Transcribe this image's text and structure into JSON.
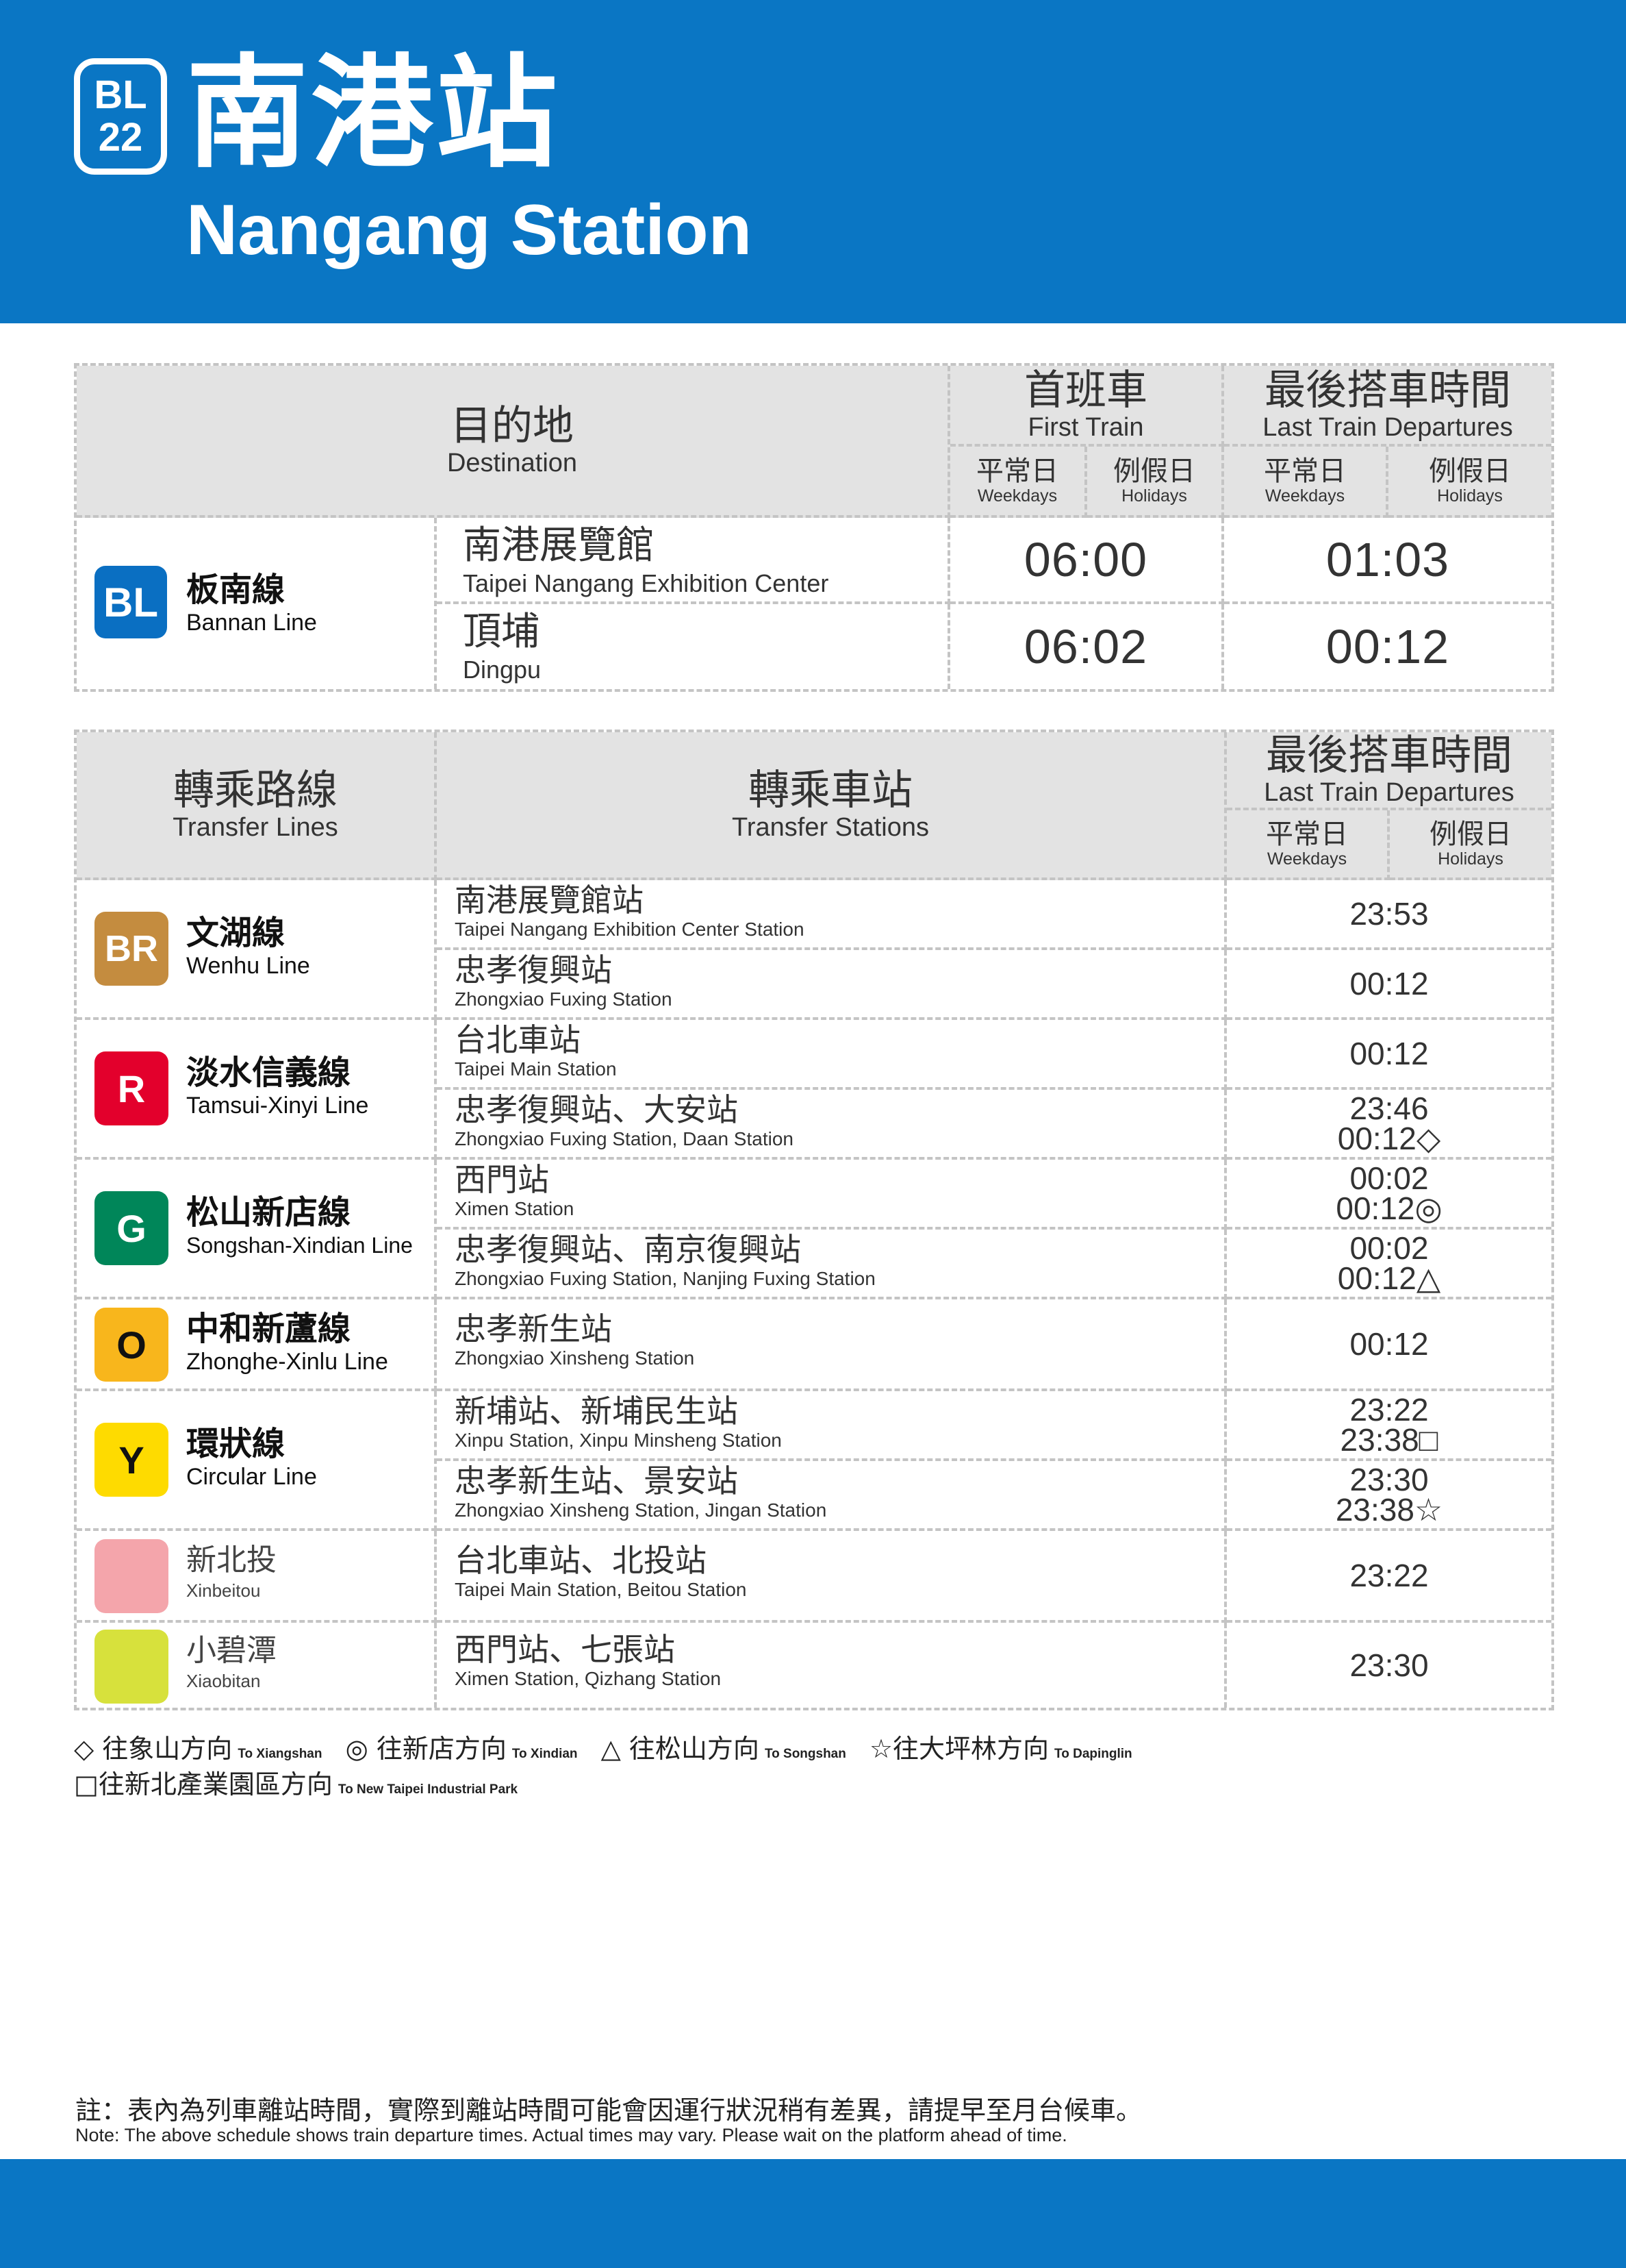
{
  "station": {
    "code_line": "BL",
    "code_num": "22",
    "name_zh": "南港站",
    "name_en": "Nangang Station"
  },
  "schedule": {
    "dest_zh": "目的地",
    "dest_en": "Destination",
    "first_zh": "首班車",
    "first_en": "First Train",
    "last_zh": "最後搭車時間",
    "last_en": "Last Train Departures",
    "weekdays_zh": "平常日",
    "weekdays_en": "Weekdays",
    "holidays_zh": "例假日",
    "holidays_en": "Holidays",
    "line_badge": "BL",
    "line_zh": "板南線",
    "line_en": "Bannan Line",
    "line_color": "#0a6fc2",
    "rows": [
      {
        "zh": "南港展覽館",
        "en": "Taipei Nangang Exhibition Center",
        "first": "06:00",
        "last": "01:03"
      },
      {
        "zh": "頂埔",
        "en": "Dingpu",
        "first": "06:02",
        "last": "00:12"
      }
    ]
  },
  "transfer": {
    "lines_zh": "轉乘路線",
    "lines_en": "Transfer Lines",
    "stations_zh": "轉乘車站",
    "stations_en": "Transfer Stations",
    "last_zh": "最後搭車時間",
    "last_en": "Last Train Departures",
    "weekdays_zh": "平常日",
    "weekdays_en": "Weekdays",
    "holidays_zh": "例假日",
    "holidays_en": "Holidays",
    "groups": [
      {
        "badge": "BR",
        "color": "#c48c3f",
        "zh": "文湖線",
        "en": "Wenhu Line",
        "rows": [
          {
            "zh": "南港展覽館站",
            "en": "Taipei Nangang Exhibition Center Station",
            "t1": "23:53",
            "t2": ""
          },
          {
            "zh": "忠孝復興站",
            "en": "Zhongxiao Fuxing Station",
            "t1": "00:12",
            "t2": ""
          }
        ]
      },
      {
        "badge": "R",
        "color": "#e3002c",
        "zh": "淡水信義線",
        "en": "Tamsui-Xinyi Line",
        "rows": [
          {
            "zh": "台北車站",
            "en": "Taipei Main Station",
            "t1": "00:12",
            "t2": ""
          },
          {
            "zh": "忠孝復興站、大安站",
            "en": "Zhongxiao Fuxing Station, Daan Station",
            "t1": "23:46",
            "t2": "00:12◇"
          }
        ]
      },
      {
        "badge": "G",
        "color": "#008659",
        "zh": "松山新店線",
        "en": "Songshan-Xindian Line",
        "rows": [
          {
            "zh": "西門站",
            "en": "Ximen Station",
            "t1": "00:02",
            "t2": "00:12◎"
          },
          {
            "zh": "忠孝復興站、南京復興站",
            "en": "Zhongxiao Fuxing Station, Nanjing Fuxing Station",
            "t1": "00:02",
            "t2": "00:12△"
          }
        ]
      },
      {
        "badge": "O",
        "color": "#f8b61c",
        "zh": "中和新蘆線",
        "en": "Zhonghe-Xinlu Line",
        "rows": [
          {
            "zh": "忠孝新生站",
            "en": "Zhongxiao Xinsheng Station",
            "t1": "00:12",
            "t2": ""
          }
        ]
      },
      {
        "badge": "Y",
        "color": "#fedb00",
        "zh": "環狀線",
        "en": "Circular Line",
        "rows": [
          {
            "zh": "新埔站、新埔民生站",
            "en": "Xinpu Station, Xinpu Minsheng Station",
            "t1": "23:22",
            "t2": "23:38□"
          },
          {
            "zh": "忠孝新生站、景安站",
            "en": "Zhongxiao Xinsheng Station, Jingan Station",
            "t1": "23:30",
            "t2": "23:38☆"
          }
        ]
      },
      {
        "badge": "",
        "color": "#f4a5ab",
        "zh": "新北投",
        "en": "Xinbeitou",
        "rows": [
          {
            "zh": "台北車站、北投站",
            "en": "Taipei Main Station, Beitou Station",
            "t1": "23:22",
            "t2": ""
          }
        ]
      },
      {
        "badge": "",
        "color": "#d7e13c",
        "zh": "小碧潭",
        "en": "Xiaobitan",
        "rows": [
          {
            "zh": "西門站、七張站",
            "en": "Ximen Station, Qizhang Station",
            "t1": "23:30",
            "t2": ""
          }
        ]
      }
    ]
  },
  "legend": [
    {
      "zh": "◇ 往象山方向",
      "en": "To Xiangshan"
    },
    {
      "zh": "◎ 往新店方向",
      "en": "To Xindian"
    },
    {
      "zh": "△ 往松山方向",
      "en": "To Songshan"
    },
    {
      "zh": "☆往大坪林方向",
      "en": "To Dapinglin"
    },
    {
      "zh": "□往新北產業園區方向",
      "en": "To New Taipei Industrial Park"
    }
  ],
  "note": {
    "zh": "註：表內為列車離站時間，實際到離站時間可能會因運行狀況稍有差異，請提早至月台候車。",
    "en": "Note: The above schedule shows train departure times. Actual times may vary. Please wait on the platform ahead of time."
  }
}
